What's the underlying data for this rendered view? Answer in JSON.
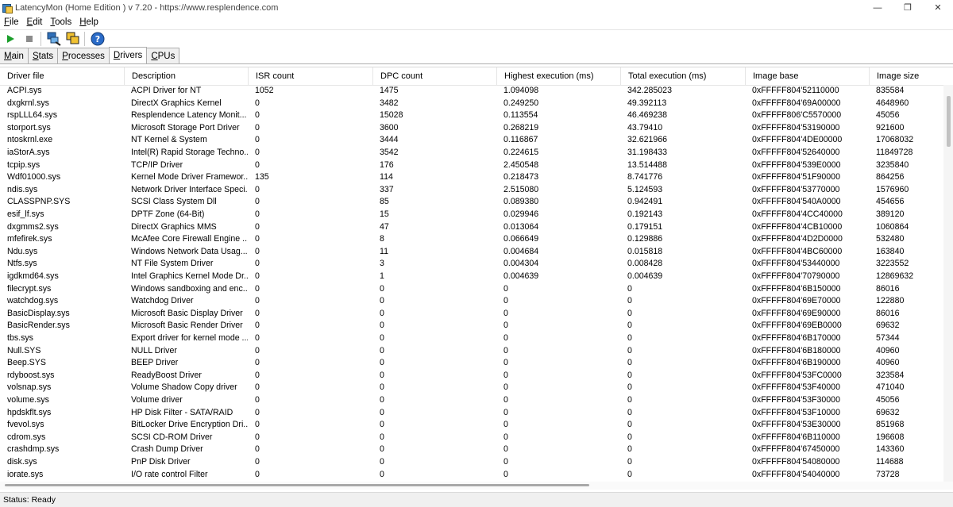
{
  "window": {
    "title": "LatencyMon  (Home Edition )  v 7.20 - https://www.resplendence.com",
    "minimize": "—",
    "restore": "❐",
    "close": "✕"
  },
  "menu": {
    "items": [
      {
        "first": "F",
        "rest": "ile"
      },
      {
        "first": "E",
        "rest": "dit"
      },
      {
        "first": "T",
        "rest": "ools"
      },
      {
        "first": "H",
        "rest": "elp"
      }
    ]
  },
  "toolbar": {
    "play_color": "#1a9e2a",
    "stop_color": "#8c8c8c"
  },
  "tabs": [
    {
      "first": "M",
      "rest": "ain",
      "active": false
    },
    {
      "first": "S",
      "rest": "tats",
      "active": false
    },
    {
      "first": "P",
      "rest": "rocesses",
      "active": false
    },
    {
      "first": "D",
      "rest": "rivers",
      "active": true
    },
    {
      "first": "C",
      "rest": "PUs",
      "active": false
    }
  ],
  "table": {
    "columns": [
      "Driver file",
      "Description",
      "ISR count",
      "DPC count",
      "Highest execution (ms)",
      "Total execution (ms)",
      "Image base",
      "Image size"
    ],
    "rows": [
      [
        "ACPI.sys",
        "ACPI Driver for NT",
        "1052",
        "1475",
        "1.094098",
        "342.285023",
        "0xFFFFF804'52110000",
        "835584"
      ],
      [
        "dxgkrnl.sys",
        "DirectX Graphics Kernel",
        "0",
        "3482",
        "0.249250",
        "49.392113",
        "0xFFFFF804'69A00000",
        "4648960"
      ],
      [
        "rspLLL64.sys",
        "Resplendence Latency Monit...",
        "0",
        "15028",
        "0.113554",
        "46.469238",
        "0xFFFFF806'C5570000",
        "45056"
      ],
      [
        "storport.sys",
        "Microsoft Storage Port Driver",
        "0",
        "3600",
        "0.268219",
        "43.79410",
        "0xFFFFF804'53190000",
        "921600"
      ],
      [
        "ntoskrnl.exe",
        "NT Kernel & System",
        "0",
        "3444",
        "0.116867",
        "32.621966",
        "0xFFFFF804'4DE00000",
        "17068032"
      ],
      [
        "iaStorA.sys",
        "Intel(R) Rapid Storage Techno...",
        "0",
        "3542",
        "0.224615",
        "31.198433",
        "0xFFFFF804'52640000",
        "11849728"
      ],
      [
        "tcpip.sys",
        "TCP/IP Driver",
        "0",
        "176",
        "2.450548",
        "13.514488",
        "0xFFFFF804'539E0000",
        "3235840"
      ],
      [
        "Wdf01000.sys",
        "Kernel Mode Driver Framewor...",
        "135",
        "114",
        "0.218473",
        "8.741776",
        "0xFFFFF804'51F90000",
        "864256"
      ],
      [
        "ndis.sys",
        "Network Driver Interface Speci...",
        "0",
        "337",
        "2.515080",
        "5.124593",
        "0xFFFFF804'53770000",
        "1576960"
      ],
      [
        "CLASSPNP.SYS",
        "SCSI Class System Dll",
        "0",
        "85",
        "0.089380",
        "0.942491",
        "0xFFFFF804'540A0000",
        "454656"
      ],
      [
        "esif_lf.sys",
        "DPTF Zone (64-Bit)",
        "0",
        "15",
        "0.029946",
        "0.192143",
        "0xFFFFF804'4CC40000",
        "389120"
      ],
      [
        "dxgmms2.sys",
        "DirectX Graphics MMS",
        "0",
        "47",
        "0.013064",
        "0.179151",
        "0xFFFFF804'4CB10000",
        "1060864"
      ],
      [
        "mfefirek.sys",
        "McAfee Core Firewall Engine ...",
        "0",
        "8",
        "0.066649",
        "0.129886",
        "0xFFFFF804'4D2D0000",
        "532480"
      ],
      [
        "Ndu.sys",
        "Windows Network Data Usag...",
        "0",
        "11",
        "0.004684",
        "0.015818",
        "0xFFFFF804'4BC60000",
        "163840"
      ],
      [
        "Ntfs.sys",
        "NT File System Driver",
        "0",
        "3",
        "0.004304",
        "0.008428",
        "0xFFFFF804'53440000",
        "3223552"
      ],
      [
        "igdkmd64.sys",
        "Intel Graphics Kernel Mode Dr...",
        "0",
        "1",
        "0.004639",
        "0.004639",
        "0xFFFFF804'70790000",
        "12869632"
      ],
      [
        "filecrypt.sys",
        "Windows sandboxing and enc...",
        "0",
        "0",
        "0",
        "0",
        "0xFFFFF804'6B150000",
        "86016"
      ],
      [
        "watchdog.sys",
        "Watchdog Driver",
        "0",
        "0",
        "0",
        "0",
        "0xFFFFF804'69E70000",
        "122880"
      ],
      [
        "BasicDisplay.sys",
        "Microsoft Basic Display Driver",
        "0",
        "0",
        "0",
        "0",
        "0xFFFFF804'69E90000",
        "86016"
      ],
      [
        "BasicRender.sys",
        "Microsoft Basic Render Driver",
        "0",
        "0",
        "0",
        "0",
        "0xFFFFF804'69EB0000",
        "69632"
      ],
      [
        "tbs.sys",
        "Export driver for kernel mode ...",
        "0",
        "0",
        "0",
        "0",
        "0xFFFFF804'6B170000",
        "57344"
      ],
      [
        "Null.SYS",
        "NULL Driver",
        "0",
        "0",
        "0",
        "0",
        "0xFFFFF804'6B180000",
        "40960"
      ],
      [
        "Beep.SYS",
        "BEEP Driver",
        "0",
        "0",
        "0",
        "0",
        "0xFFFFF804'6B190000",
        "40960"
      ],
      [
        "rdyboost.sys",
        "ReadyBoost Driver",
        "0",
        "0",
        "0",
        "0",
        "0xFFFFF804'53FC0000",
        "323584"
      ],
      [
        "volsnap.sys",
        "Volume Shadow Copy driver",
        "0",
        "0",
        "0",
        "0",
        "0xFFFFF804'53F40000",
        "471040"
      ],
      [
        "volume.sys",
        "Volume driver",
        "0",
        "0",
        "0",
        "0",
        "0xFFFFF804'53F30000",
        "45056"
      ],
      [
        "hpdskflt.sys",
        "HP Disk Filter - SATA/RAID",
        "0",
        "0",
        "0",
        "0",
        "0xFFFFF804'53F10000",
        "69632"
      ],
      [
        "fvevol.sys",
        "BitLocker Drive Encryption Dri...",
        "0",
        "0",
        "0",
        "0",
        "0xFFFFF804'53E30000",
        "851968"
      ],
      [
        "cdrom.sys",
        "SCSI CD-ROM Driver",
        "0",
        "0",
        "0",
        "0",
        "0xFFFFF804'6B110000",
        "196608"
      ],
      [
        "crashdmp.sys",
        "Crash Dump Driver",
        "0",
        "0",
        "0",
        "0",
        "0xFFFFF804'67450000",
        "143360"
      ],
      [
        "disk.sys",
        "PnP Disk Driver",
        "0",
        "0",
        "0",
        "0",
        "0xFFFFF804'54080000",
        "114688"
      ],
      [
        "iorate.sys",
        "I/O rate control Filter",
        "0",
        "0",
        "0",
        "0",
        "0xFFFFF804'54040000",
        "73728"
      ]
    ]
  },
  "status": {
    "text": "Status: Ready"
  }
}
